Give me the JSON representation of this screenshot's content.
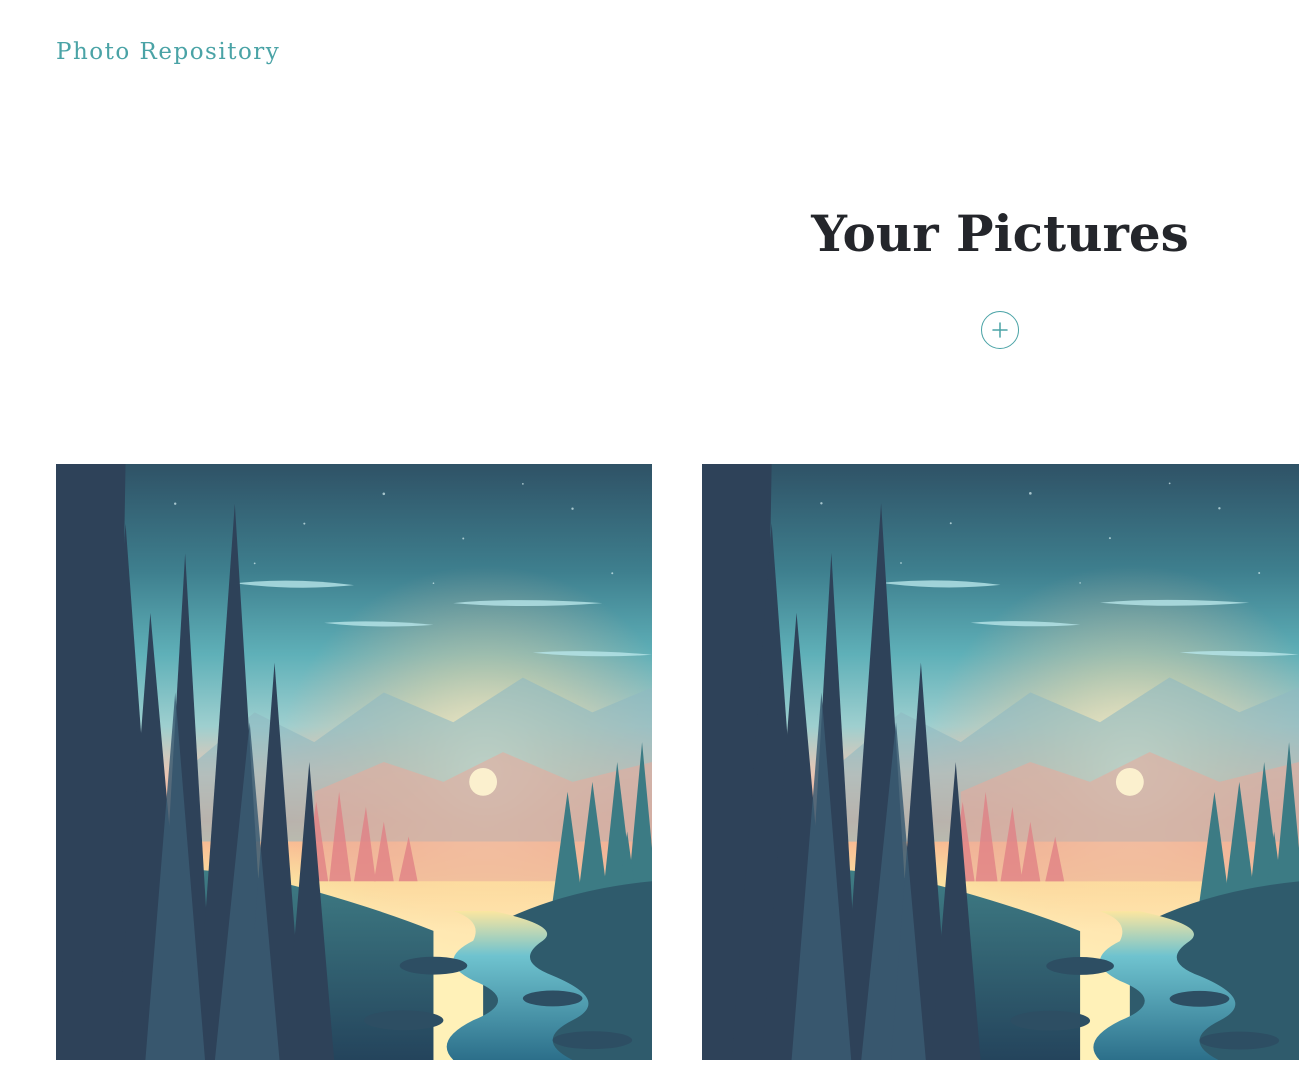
{
  "header": {
    "brand": "Photo Repository"
  },
  "main": {
    "title": "Your Pictures",
    "add_button": {
      "icon": "plus-icon",
      "color": "#4aa3a6"
    },
    "photos": [
      {
        "subject": "forest river sunset illustration"
      },
      {
        "subject": "forest river sunset illustration"
      }
    ]
  },
  "colors": {
    "accent": "#4aa3a6",
    "title": "#24262b",
    "background": "#ffffff"
  }
}
